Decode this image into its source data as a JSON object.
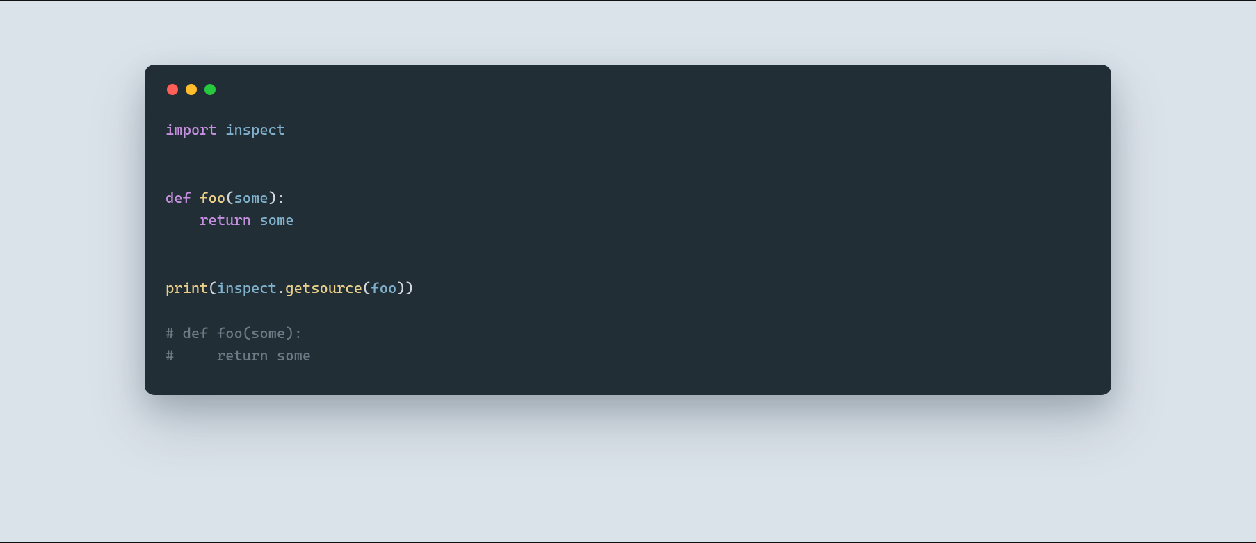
{
  "colors": {
    "page_bg": "#dbe3ea",
    "window_bg": "#222e36",
    "light_red": "#ff5f56",
    "light_yellow": "#ffbd2e",
    "light_green": "#27c93f",
    "keyword": "#c690e0",
    "identifier": "#7fb1cc",
    "function": "#e9cf8a",
    "punctuation": "#d1d8de",
    "comment": "#6c7a85"
  },
  "code": {
    "language": "python",
    "lines": [
      {
        "n": 1,
        "tokens": [
          {
            "t": "import",
            "c": "key"
          },
          {
            "t": " "
          },
          {
            "t": "inspect",
            "c": "mod"
          }
        ]
      },
      {
        "n": 2,
        "tokens": []
      },
      {
        "n": 3,
        "tokens": []
      },
      {
        "n": 4,
        "tokens": [
          {
            "t": "def",
            "c": "key"
          },
          {
            "t": " "
          },
          {
            "t": "foo",
            "c": "func"
          },
          {
            "t": "(",
            "c": "punc"
          },
          {
            "t": "some",
            "c": "mod"
          },
          {
            "t": ")",
            "c": "punc"
          },
          {
            "t": ":",
            "c": "punc"
          }
        ]
      },
      {
        "n": 5,
        "tokens": [
          {
            "t": "    "
          },
          {
            "t": "return",
            "c": "key"
          },
          {
            "t": " "
          },
          {
            "t": "some",
            "c": "mod"
          }
        ]
      },
      {
        "n": 6,
        "tokens": []
      },
      {
        "n": 7,
        "tokens": []
      },
      {
        "n": 8,
        "tokens": [
          {
            "t": "print",
            "c": "func"
          },
          {
            "t": "(",
            "c": "punc"
          },
          {
            "t": "inspect",
            "c": "mod"
          },
          {
            "t": ".",
            "c": "punc"
          },
          {
            "t": "getsource",
            "c": "func"
          },
          {
            "t": "(",
            "c": "punc"
          },
          {
            "t": "foo",
            "c": "mod"
          },
          {
            "t": ")",
            "c": "punc"
          },
          {
            "t": ")",
            "c": "punc"
          }
        ]
      },
      {
        "n": 9,
        "tokens": []
      },
      {
        "n": 10,
        "tokens": [
          {
            "t": "# def foo(some):",
            "c": "comm"
          }
        ]
      },
      {
        "n": 11,
        "tokens": [
          {
            "t": "#     return some",
            "c": "comm"
          }
        ]
      }
    ],
    "plain_text": "import inspect\n\n\ndef foo(some):\n    return some\n\n\nprint(inspect.getsource(foo))\n\n# def foo(some):\n#     return some"
  }
}
